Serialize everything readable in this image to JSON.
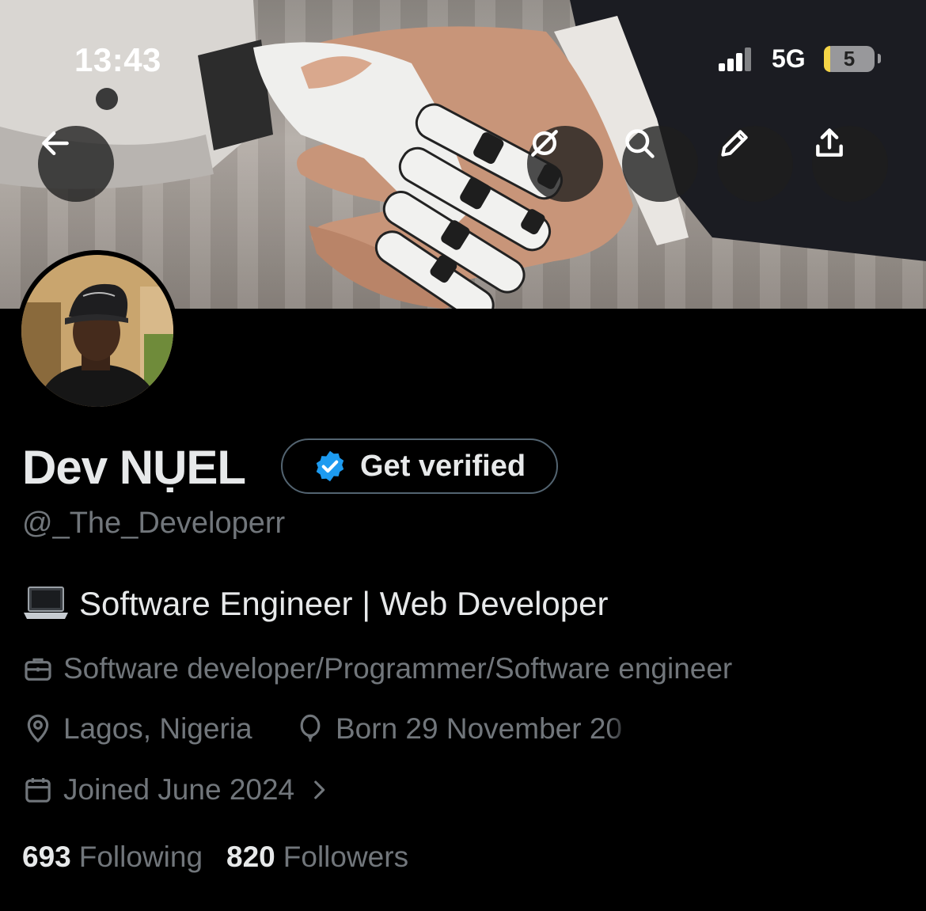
{
  "status_bar": {
    "time": "13:43",
    "network": "5G",
    "battery_level": "5"
  },
  "header": {
    "back_icon": "arrow-left-icon",
    "actions": [
      "grok-icon",
      "search-icon",
      "edit-icon",
      "share-icon"
    ]
  },
  "profile": {
    "name": "Dev NỤEL",
    "get_verified_label": "Get verified",
    "handle": "@_The_Developerr",
    "bio_emoji": "laptop-icon",
    "bio": "Software Engineer | Web Developer",
    "profession": "Software developer/Programmer/Software engineer",
    "location": "Lagos, Nigeria",
    "birthday": "Born 29 November 20",
    "joined": "Joined June 2024",
    "following_count": "693",
    "following_label": "Following",
    "followers_count": "820",
    "followers_label": "Followers"
  },
  "colors": {
    "background": "#000000",
    "primary_text": "#e7e9ea",
    "secondary_text": "#71767b",
    "verified_blue": "#1d9bf0",
    "border": "#536471"
  }
}
